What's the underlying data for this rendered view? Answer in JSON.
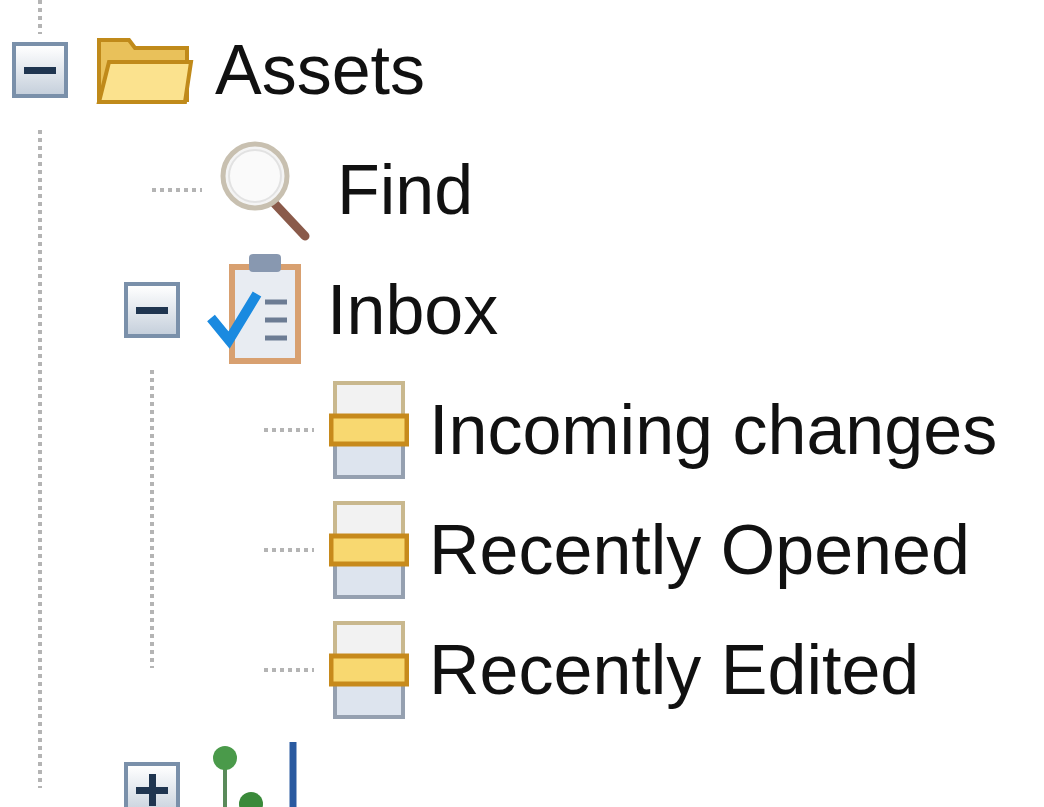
{
  "tree": [
    {
      "label": "Assets",
      "kind": "folder",
      "expanded": true,
      "children": [
        {
          "label": "Find",
          "kind": "search"
        },
        {
          "label": "Inbox",
          "kind": "checklist",
          "expanded": true,
          "children": [
            {
              "label": "Incoming changes",
              "kind": "stack"
            },
            {
              "label": "Recently Opened",
              "kind": "stack"
            },
            {
              "label": "Recently Edited",
              "kind": "stack"
            }
          ]
        },
        {
          "kind": "status",
          "expanded": false
        }
      ]
    }
  ]
}
